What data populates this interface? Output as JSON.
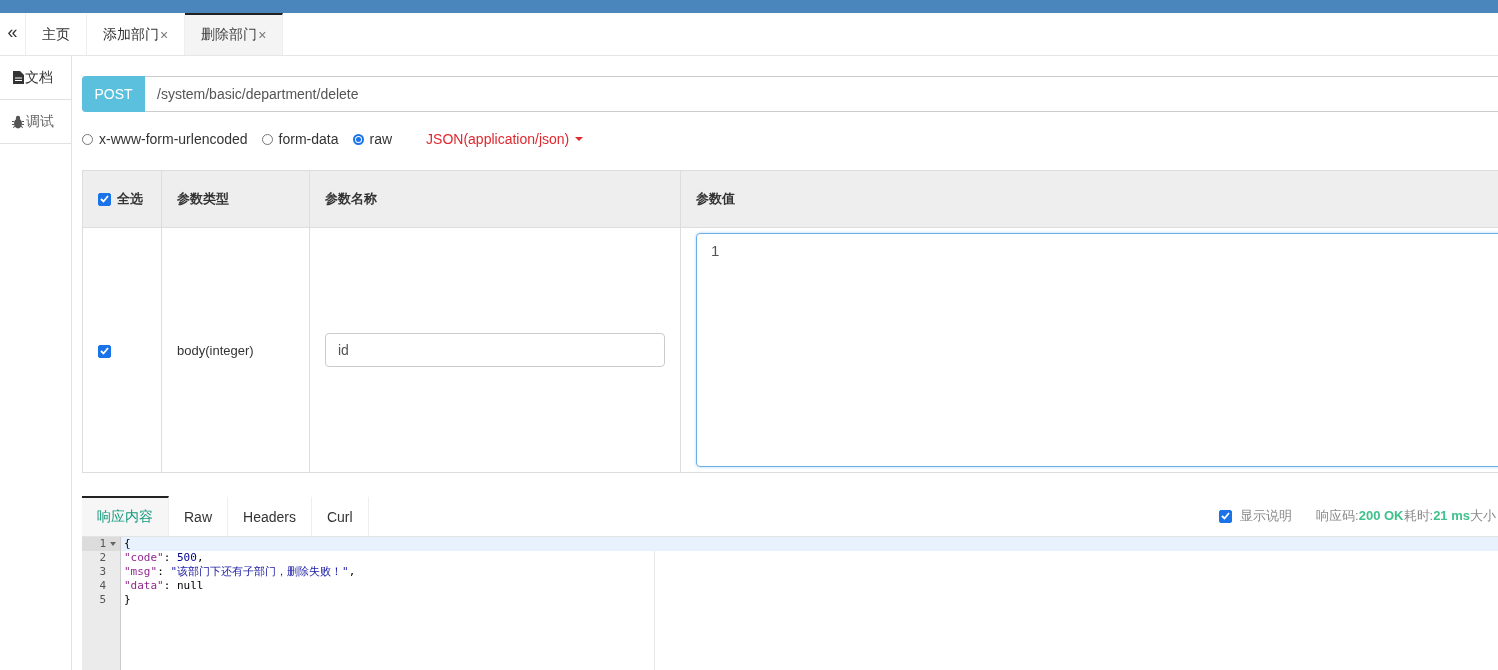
{
  "tabs": [
    {
      "label": "主页",
      "selected": false
    },
    {
      "label": "添加部门",
      "close": "×",
      "selected": false
    },
    {
      "label": "删除部门",
      "close": "×",
      "selected": true
    }
  ],
  "collapse_glyph": "«",
  "sidebar": {
    "items": [
      {
        "label": "文档",
        "kind": "document",
        "selected": false
      },
      {
        "label": "调试",
        "kind": "bug",
        "selected": true
      }
    ]
  },
  "request": {
    "method": "POST",
    "url": "/system/basic/department/delete"
  },
  "body_types": [
    {
      "label": "x-www-form-urlencoded",
      "selected": false
    },
    {
      "label": "form-data",
      "selected": false
    },
    {
      "label": "raw",
      "selected": true
    }
  ],
  "content_type": "JSON(application/json)",
  "table": {
    "select_all": {
      "label": "全选",
      "checked": true
    },
    "columns": [
      "参数类型",
      "参数名称",
      "参数值"
    ],
    "rows": [
      {
        "checked": true,
        "type": "body(integer)",
        "name": "id",
        "value": "1"
      }
    ]
  },
  "response": {
    "tabs": [
      {
        "label": "响应内容",
        "selected": true
      },
      {
        "label": "Raw",
        "selected": false
      },
      {
        "label": "Headers",
        "selected": false
      },
      {
        "label": "Curl",
        "selected": false
      }
    ],
    "show_description": {
      "label": "显示说明",
      "checked": true
    },
    "status": [
      {
        "kind": "label",
        "text": "响应码:"
      },
      {
        "kind": "value",
        "text": "200 OK"
      },
      {
        "kind": "label",
        "text": "耗时:"
      },
      {
        "kind": "value",
        "text": "21 ms"
      },
      {
        "kind": "label",
        "text": "大小"
      }
    ],
    "lines": [
      {
        "number": "1",
        "fold": true,
        "active": true,
        "tokens": [
          {
            "kind": "punct",
            "text": "{"
          }
        ]
      },
      {
        "number": "2",
        "fold": false,
        "active": false,
        "tokens": [
          {
            "kind": "key",
            "text": "\"code\""
          },
          {
            "kind": "punct",
            "text": ": "
          },
          {
            "kind": "number",
            "text": "500"
          },
          {
            "kind": "punct",
            "text": ","
          }
        ]
      },
      {
        "number": "3",
        "fold": false,
        "active": false,
        "tokens": [
          {
            "kind": "key",
            "text": "\"msg\""
          },
          {
            "kind": "punct",
            "text": ": "
          },
          {
            "kind": "string",
            "text": "\"该部门下还有子部门，删除失败！\""
          },
          {
            "kind": "punct",
            "text": ","
          }
        ]
      },
      {
        "number": "4",
        "fold": false,
        "active": false,
        "tokens": [
          {
            "kind": "key",
            "text": "\"data\""
          },
          {
            "kind": "punct",
            "text": ": "
          },
          {
            "kind": "null",
            "text": "null"
          }
        ]
      },
      {
        "number": "5",
        "fold": false,
        "active": false,
        "tokens": [
          {
            "kind": "punct",
            "text": "}"
          }
        ]
      }
    ]
  }
}
